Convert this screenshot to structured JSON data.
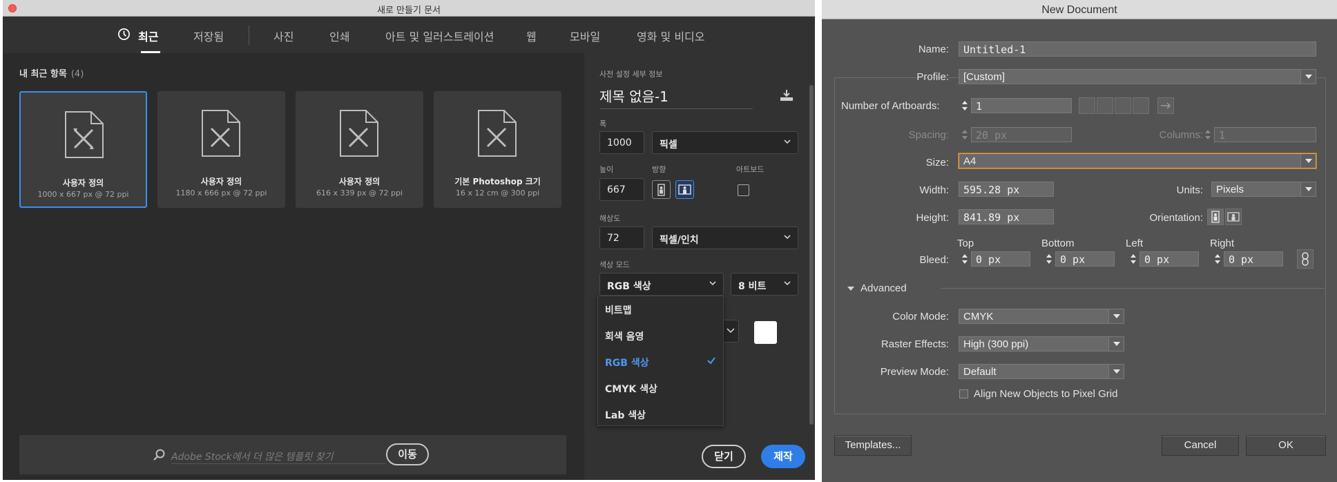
{
  "photoshop": {
    "window_title": "새로 만들기 문서",
    "tabs": [
      {
        "label": "최근",
        "active": true
      },
      {
        "label": "저장됨"
      },
      {
        "label": "사진"
      },
      {
        "label": "인쇄"
      },
      {
        "label": "아트 및 일러스트레이션"
      },
      {
        "label": "웹"
      },
      {
        "label": "모바일"
      },
      {
        "label": "영화 및 비디오"
      }
    ],
    "recent_heading": "내 최근 항목",
    "recent_count": "(4)",
    "cards": [
      {
        "title": "사용자 정의",
        "sub": "1000 x 667 px @ 72 ppi",
        "selected": true
      },
      {
        "title": "사용자 정의",
        "sub": "1180 x 666 px @ 72 ppi"
      },
      {
        "title": "사용자 정의",
        "sub": "616 x 339 px @ 72 ppi"
      },
      {
        "title": "기본 Photoshop 크기",
        "sub": "16 x 12 cm @ 300 ppi"
      }
    ],
    "search_placeholder": "Adobe Stock에서 더 많은 템플릿 찾기",
    "go_label": "이동",
    "preset": {
      "section_label": "사전 설정 세부 정보",
      "name": "제목 없음-1",
      "width_label": "폭",
      "width_value": "1000",
      "width_unit": "픽셀",
      "height_label": "높이",
      "height_value": "667",
      "orientation_label": "방향",
      "artboard_label": "아트보드",
      "resolution_label": "해상도",
      "resolution_value": "72",
      "resolution_unit": "픽셀/인치",
      "color_mode_label": "색상 모드",
      "color_mode_value": "RGB 색상",
      "bit_depth": "8 비트",
      "color_mode_options": [
        "비트맵",
        "회색 음영",
        "RGB 색상",
        "CMYK 색상",
        "Lab 색상"
      ],
      "selected_option": "RGB 색상"
    },
    "close_label": "닫기",
    "create_label": "제작"
  },
  "illustrator": {
    "window_title": "New Document",
    "name_label": "Name:",
    "name_value": "Untitled-1",
    "profile_label": "Profile:",
    "profile_value": "[Custom]",
    "artboards_label": "Number of Artboards:",
    "artboards_value": "1",
    "spacing_label": "Spacing:",
    "spacing_value": "20 px",
    "columns_label": "Columns:",
    "columns_value": "1",
    "size_label": "Size:",
    "size_value": "A4",
    "width_label": "Width:",
    "width_value": "595.28 px",
    "units_label": "Units:",
    "units_value": "Pixels",
    "height_label": "Height:",
    "height_value": "841.89 px",
    "orientation_label": "Orientation:",
    "bleed_label": "Bleed:",
    "bleed_top_label": "Top",
    "bleed_bottom_label": "Bottom",
    "bleed_left_label": "Left",
    "bleed_right_label": "Right",
    "bleed_top": "0 px",
    "bleed_bottom": "0 px",
    "bleed_left": "0 px",
    "bleed_right": "0 px",
    "advanced_label": "Advanced",
    "color_mode_label": "Color Mode:",
    "color_mode_value": "CMYK",
    "raster_label": "Raster Effects:",
    "raster_value": "High (300 ppi)",
    "preview_label": "Preview Mode:",
    "preview_value": "Default",
    "align_label": "Align New Objects to Pixel Grid",
    "templates_label": "Templates...",
    "cancel_label": "Cancel",
    "ok_label": "OK"
  }
}
